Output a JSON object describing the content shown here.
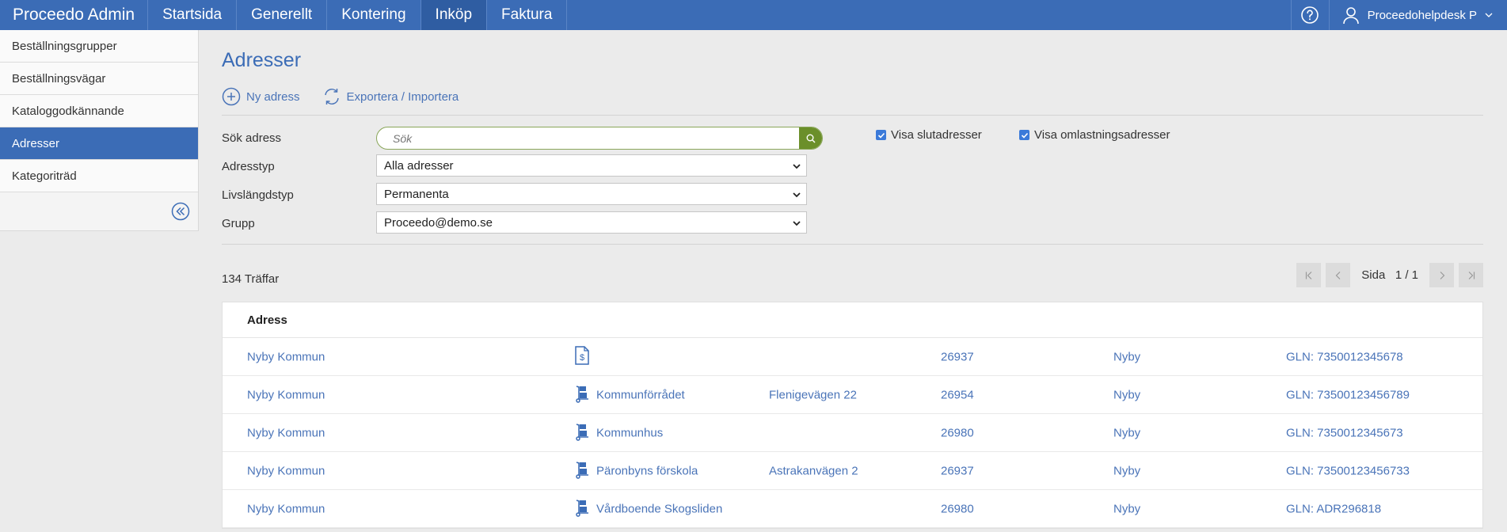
{
  "app": {
    "brand": "Proceedo Admin"
  },
  "topnav": [
    {
      "label": "Startsida",
      "active": false
    },
    {
      "label": "Generellt",
      "active": false
    },
    {
      "label": "Kontering",
      "active": false
    },
    {
      "label": "Inköp",
      "active": true
    },
    {
      "label": "Faktura",
      "active": false
    }
  ],
  "user": {
    "name": "Proceedohelpdesk P"
  },
  "sidebar": {
    "items": [
      {
        "label": "Beställningsgrupper",
        "active": false
      },
      {
        "label": "Beställningsvägar",
        "active": false
      },
      {
        "label": "Kataloggodkännande",
        "active": false
      },
      {
        "label": "Adresser",
        "active": true
      },
      {
        "label": "Kategoriträd",
        "active": false
      }
    ]
  },
  "page": {
    "title": "Adresser",
    "actions": {
      "new": "Ny adress",
      "export": "Exportera / Importera"
    }
  },
  "filters": {
    "search_label": "Sök adress",
    "search_placeholder": "Sök",
    "type_label": "Adresstyp",
    "type_value": "Alla adresser",
    "life_label": "Livslängdstyp",
    "life_value": "Permanenta",
    "group_label": "Grupp",
    "group_value": "Proceedo@demo.se",
    "show_final": "Visa slutadresser",
    "show_reload": "Visa omlastningsadresser"
  },
  "results": {
    "hits": "134 Träffar",
    "page_label": "Sida",
    "page_value": "1 / 1"
  },
  "table": {
    "header": "Adress",
    "rows": [
      {
        "name": "Nyby Kommun",
        "icon": "invoice-icon",
        "label": "",
        "street": "",
        "zip": "26937",
        "city": "Nyby",
        "gln": "GLN: 7350012345678"
      },
      {
        "name": "Nyby Kommun",
        "icon": "delivery-icon",
        "label": "Kommunförrådet",
        "street": "Flenigevägen 22",
        "zip": "26954",
        "city": "Nyby",
        "gln": "GLN: 73500123456789"
      },
      {
        "name": "Nyby Kommun",
        "icon": "delivery-icon",
        "label": "Kommunhus",
        "street": "",
        "zip": "26980",
        "city": "Nyby",
        "gln": "GLN: 7350012345673"
      },
      {
        "name": "Nyby Kommun",
        "icon": "delivery-icon",
        "label": "Päronbyns förskola",
        "street": "Astrakanvägen 2",
        "zip": "26937",
        "city": "Nyby",
        "gln": "GLN: 73500123456733"
      },
      {
        "name": "Nyby Kommun",
        "icon": "delivery-icon",
        "label": "Vårdboende Skogsliden",
        "street": "",
        "zip": "26980",
        "city": "Nyby",
        "gln": "GLN: ADR296818"
      }
    ]
  },
  "colors": {
    "primary": "#3b6cb6",
    "link": "#4a74b8",
    "search_green": "#6b8f2a"
  }
}
